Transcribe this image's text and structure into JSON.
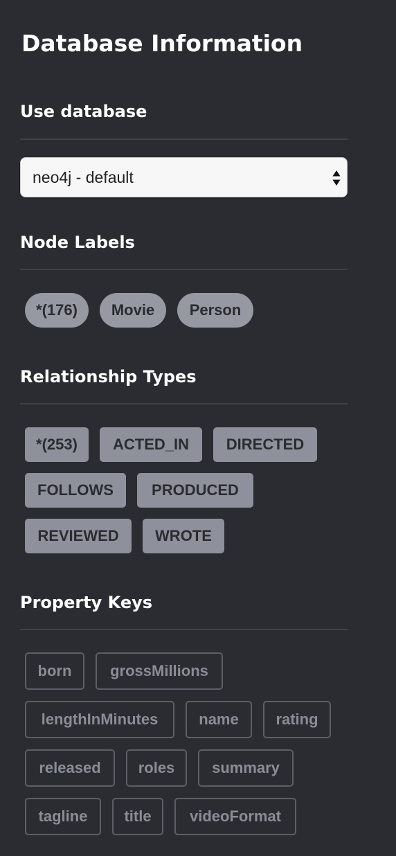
{
  "panel": {
    "title": "Database Information"
  },
  "use_database": {
    "heading": "Use database",
    "selected": "neo4j - default"
  },
  "node_labels": {
    "heading": "Node Labels",
    "items": [
      "*(176)",
      "Movie",
      "Person"
    ]
  },
  "relationship_types": {
    "heading": "Relationship Types",
    "items": [
      "*(253)",
      "ACTED_IN",
      "DIRECTED",
      "FOLLOWS",
      "PRODUCED",
      "REVIEWED",
      "WROTE"
    ]
  },
  "property_keys": {
    "heading": "Property Keys",
    "items": [
      "born",
      "grossMillions",
      "lengthInMinutes",
      "name",
      "rating",
      "released",
      "roles",
      "summary",
      "tagline",
      "title",
      "videoFormat"
    ]
  },
  "colors": {
    "background": "#2a2c31",
    "label_chip": "#9699a2",
    "relationship_chip": "#8e919b",
    "property_chip_border": "#5c5f67",
    "property_chip_text": "#8a8d95"
  }
}
